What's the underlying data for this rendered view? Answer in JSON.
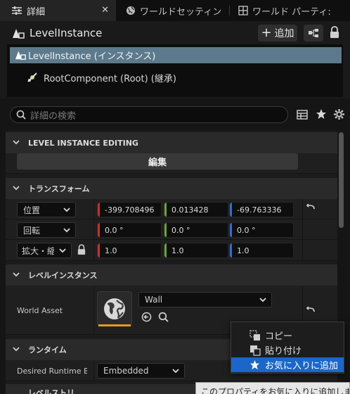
{
  "tabs": [
    {
      "label": "詳細",
      "icon": "details-icon",
      "active": true
    },
    {
      "label": "ワールドセッティン",
      "icon": "globe-icon",
      "active": false
    },
    {
      "label": "ワールド パーティ:",
      "icon": "partition-icon",
      "active": false
    }
  ],
  "actor": {
    "name": "LevelInstance",
    "add_label": "追加",
    "components": [
      {
        "label": "LevelInstance (インスタンス)",
        "selected": true
      },
      {
        "label": "RootComponent (Root) (継承)",
        "selected": false
      }
    ]
  },
  "search": {
    "placeholder": "詳細の検索"
  },
  "sections": {
    "level_instance_editing": {
      "title": "LEVEL INSTANCE EDITING",
      "edit_button": "編集"
    },
    "transform": {
      "title": "トランスフォーム",
      "location": {
        "label": "位置",
        "x": "-399.708496",
        "y": "0.013428",
        "z": "-69.763336"
      },
      "rotation": {
        "label": "回転",
        "x": "0.0 °",
        "y": "0.0 °",
        "z": "0.0 °"
      },
      "scale": {
        "label": "拡大・縮小",
        "x": "1.0",
        "y": "1.0",
        "z": "1.0"
      }
    },
    "level_instance": {
      "title": "レベルインスタンス",
      "world_asset_label": "World Asset",
      "world_asset_value": "Wall"
    },
    "runtime": {
      "title": "ランタイム",
      "desired_runtime_label": "Desired Runtime Bel",
      "desired_runtime_value": "Embedded"
    },
    "next_section_partial": "レベルストリ"
  },
  "context_menu": {
    "items": [
      {
        "label": "コピー",
        "icon": "copy-icon",
        "highlighted": false
      },
      {
        "label": "貼り付け",
        "icon": "paste-icon",
        "highlighted": false
      },
      {
        "label": "お気に入りに追加",
        "icon": "star-icon",
        "highlighted": true
      }
    ]
  },
  "tooltip": {
    "text": "このプロパティをお気に入りに追加します。"
  },
  "colors": {
    "x_axis": "#c8302a",
    "y_axis": "#6aa626",
    "z_axis": "#2f6fd6",
    "selection": "#5c7a8c",
    "menu_highlight": "#1a67c9",
    "thumbnail_underline": "#e69a1e"
  }
}
